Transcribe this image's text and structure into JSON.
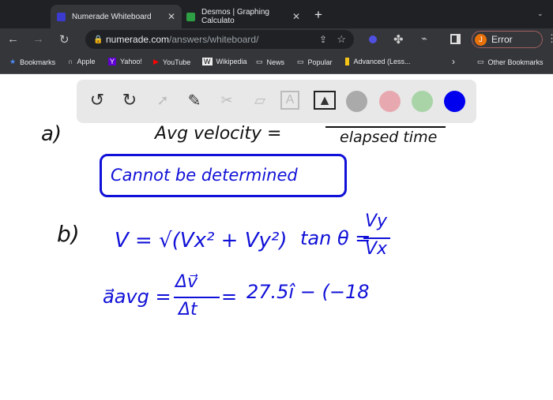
{
  "browser": {
    "tabs": [
      {
        "title": "Numerade Whiteboard",
        "active": true,
        "favicon_color": "#3b3bd0"
      },
      {
        "title": "Desmos | Graphing Calculato",
        "active": false,
        "favicon_color": "#2e9e44"
      }
    ],
    "new_tab": "+",
    "url_host": "numerade.com",
    "url_path": "/answers/whiteboard/",
    "profile": {
      "initial": "J",
      "label": "Error"
    },
    "bookmarks": [
      {
        "label": "Bookmarks",
        "icon": "star-icon"
      },
      {
        "label": "Apple",
        "icon": "apple-icon"
      },
      {
        "label": "Yahoo!",
        "icon": "yahoo-icon"
      },
      {
        "label": "YouTube",
        "icon": "youtube-icon"
      },
      {
        "label": "Wikipedia",
        "icon": "wikipedia-icon"
      },
      {
        "label": "News",
        "icon": "folder-icon"
      },
      {
        "label": "Popular",
        "icon": "folder-icon"
      },
      {
        "label": "Advanced (Less...",
        "icon": "note-icon"
      }
    ],
    "other_bookmarks": "Other Bookmarks"
  },
  "whiteboard": {
    "tools": [
      "undo",
      "redo",
      "select",
      "pen",
      "tools",
      "eraser",
      "text",
      "image"
    ],
    "colors": [
      "#aaaaaa",
      "#e8a8b0",
      "#a8d4a8",
      "#0000ee"
    ],
    "selected_color": "#0000ee",
    "notes": {
      "a_label": "a)",
      "avg_velocity": "Avg velocity =",
      "elapsed_time": "elapsed time",
      "answer_a": "Cannot be determined",
      "b_label": "b)",
      "v_formula": "V = √(Vx² + Vy²)",
      "tan_formula": "tan θ =",
      "vy": "Vy",
      "vx": "Vx",
      "a_avg": "a⃗avg =",
      "dv": "Δv⃗",
      "dt": "Δt",
      "eq2": "=",
      "value": "27.5î − (−18"
    }
  }
}
